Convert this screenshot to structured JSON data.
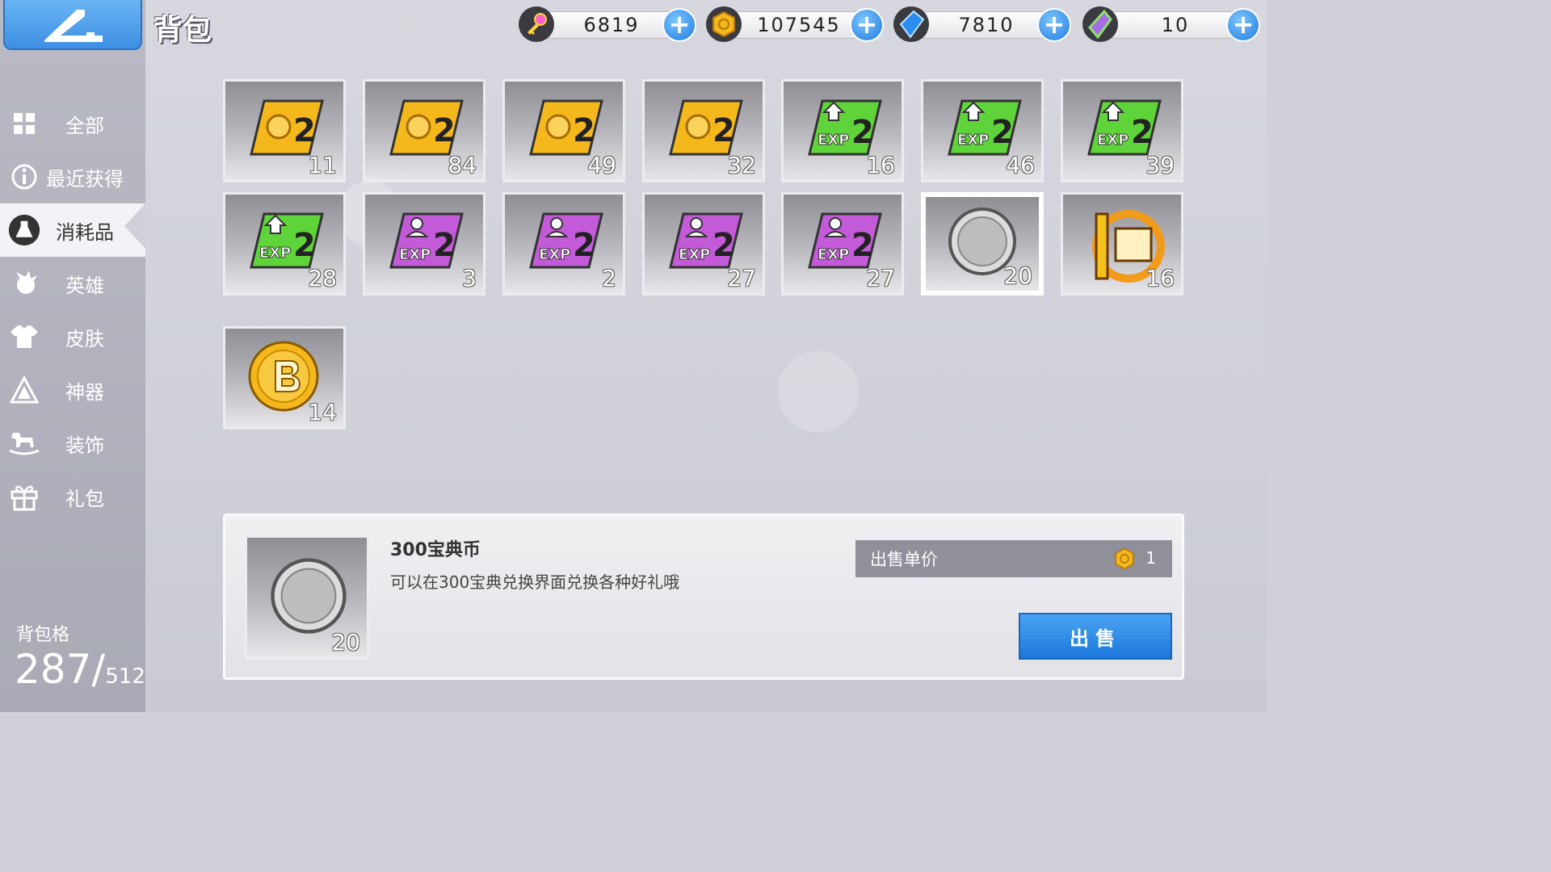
{
  "header": {
    "title": "背包"
  },
  "currencies": [
    {
      "icon": "key-icon",
      "value": "6819"
    },
    {
      "icon": "gold-coin-icon",
      "value": "107545"
    },
    {
      "icon": "blue-crystal-icon",
      "value": "7810"
    },
    {
      "icon": "rainbow-gem-icon",
      "value": "10"
    }
  ],
  "sidebar": {
    "items": [
      {
        "label": "全部",
        "icon": "grid-icon"
      },
      {
        "label": "最近获得",
        "icon": "info-icon"
      },
      {
        "label": "消耗品",
        "icon": "flask-icon"
      },
      {
        "label": "英雄",
        "icon": "hero-icon"
      },
      {
        "label": "皮肤",
        "icon": "shirt-icon"
      },
      {
        "label": "神器",
        "icon": "artifact-icon"
      },
      {
        "label": "装饰",
        "icon": "rocking-horse-icon"
      },
      {
        "label": "礼包",
        "icon": "gift-icon"
      }
    ],
    "active_index": 2,
    "capacity_label": "背包格",
    "capacity_used": "287/",
    "capacity_max": "512"
  },
  "inventory": {
    "items": [
      {
        "type": "gold-x2-card",
        "count": "11"
      },
      {
        "type": "gold-x2-card",
        "count": "84"
      },
      {
        "type": "gold-x2-card",
        "count": "49"
      },
      {
        "type": "gold-x2-card",
        "count": "32"
      },
      {
        "type": "exp-x2-green-card",
        "count": "16"
      },
      {
        "type": "exp-x2-green-card",
        "count": "46"
      },
      {
        "type": "exp-x2-green-card",
        "count": "39"
      },
      {
        "type": "exp-x2-green-card",
        "count": "28"
      },
      {
        "type": "hero-exp-x2-purple-card",
        "count": "3"
      },
      {
        "type": "hero-exp-x2-purple-card",
        "count": "2"
      },
      {
        "type": "hero-exp-x2-purple-card",
        "count": "27"
      },
      {
        "type": "hero-exp-x2-purple-card",
        "count": "27"
      },
      {
        "type": "silver-300-coin",
        "count": "20",
        "selected": true
      },
      {
        "type": "anniversary-badge",
        "count": "16"
      },
      {
        "type": "bitcoin-gold-coin",
        "count": "14"
      }
    ]
  },
  "detail": {
    "name": "300宝典币",
    "description": "可以在300宝典兑换界面兑换各种好礼哦",
    "count": "20",
    "price_label": "出售单价",
    "price_value": "1",
    "sell_label": "出售"
  },
  "colors": {
    "accent_blue": "#2f86e6",
    "gold": "#f5b81c",
    "exp_green": "#5fd43a",
    "exp_purple": "#c35ad8"
  }
}
